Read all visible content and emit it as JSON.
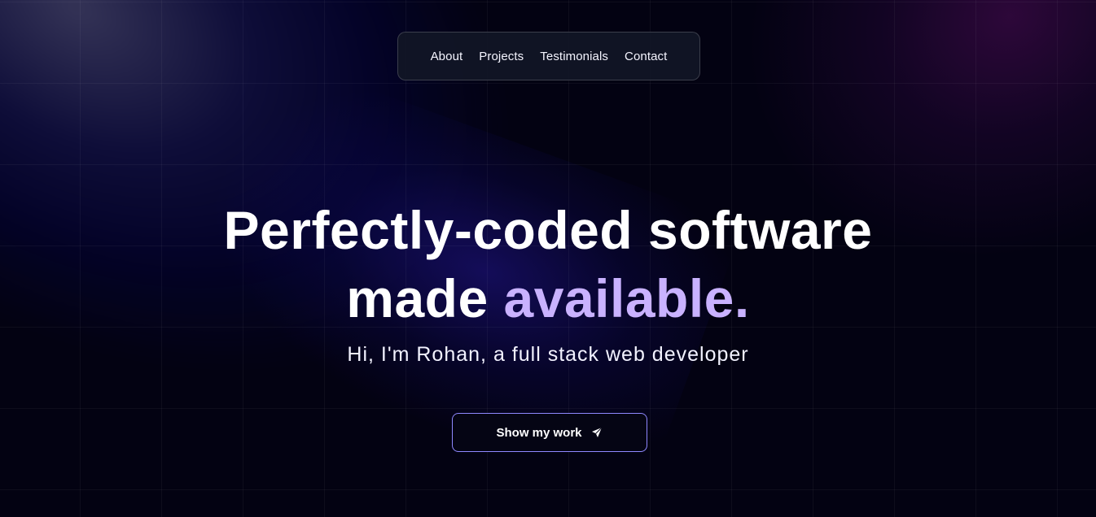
{
  "nav": {
    "items": [
      "About",
      "Projects",
      "Testimonials",
      "Contact"
    ]
  },
  "hero": {
    "title_line_1": "Perfectly-coded software",
    "title_line_2_prefix": "made",
    "title_line_2_accent": "available.",
    "subtitle": "Hi, I'm Rohan, a full stack web developer"
  },
  "cta": {
    "label": "Show my work",
    "icon": "paper-plane-icon"
  },
  "colors": {
    "background": "#030212",
    "accent_text": "#c9b2ff",
    "button_border": "#8f88ff",
    "nav_background": "#111626"
  }
}
